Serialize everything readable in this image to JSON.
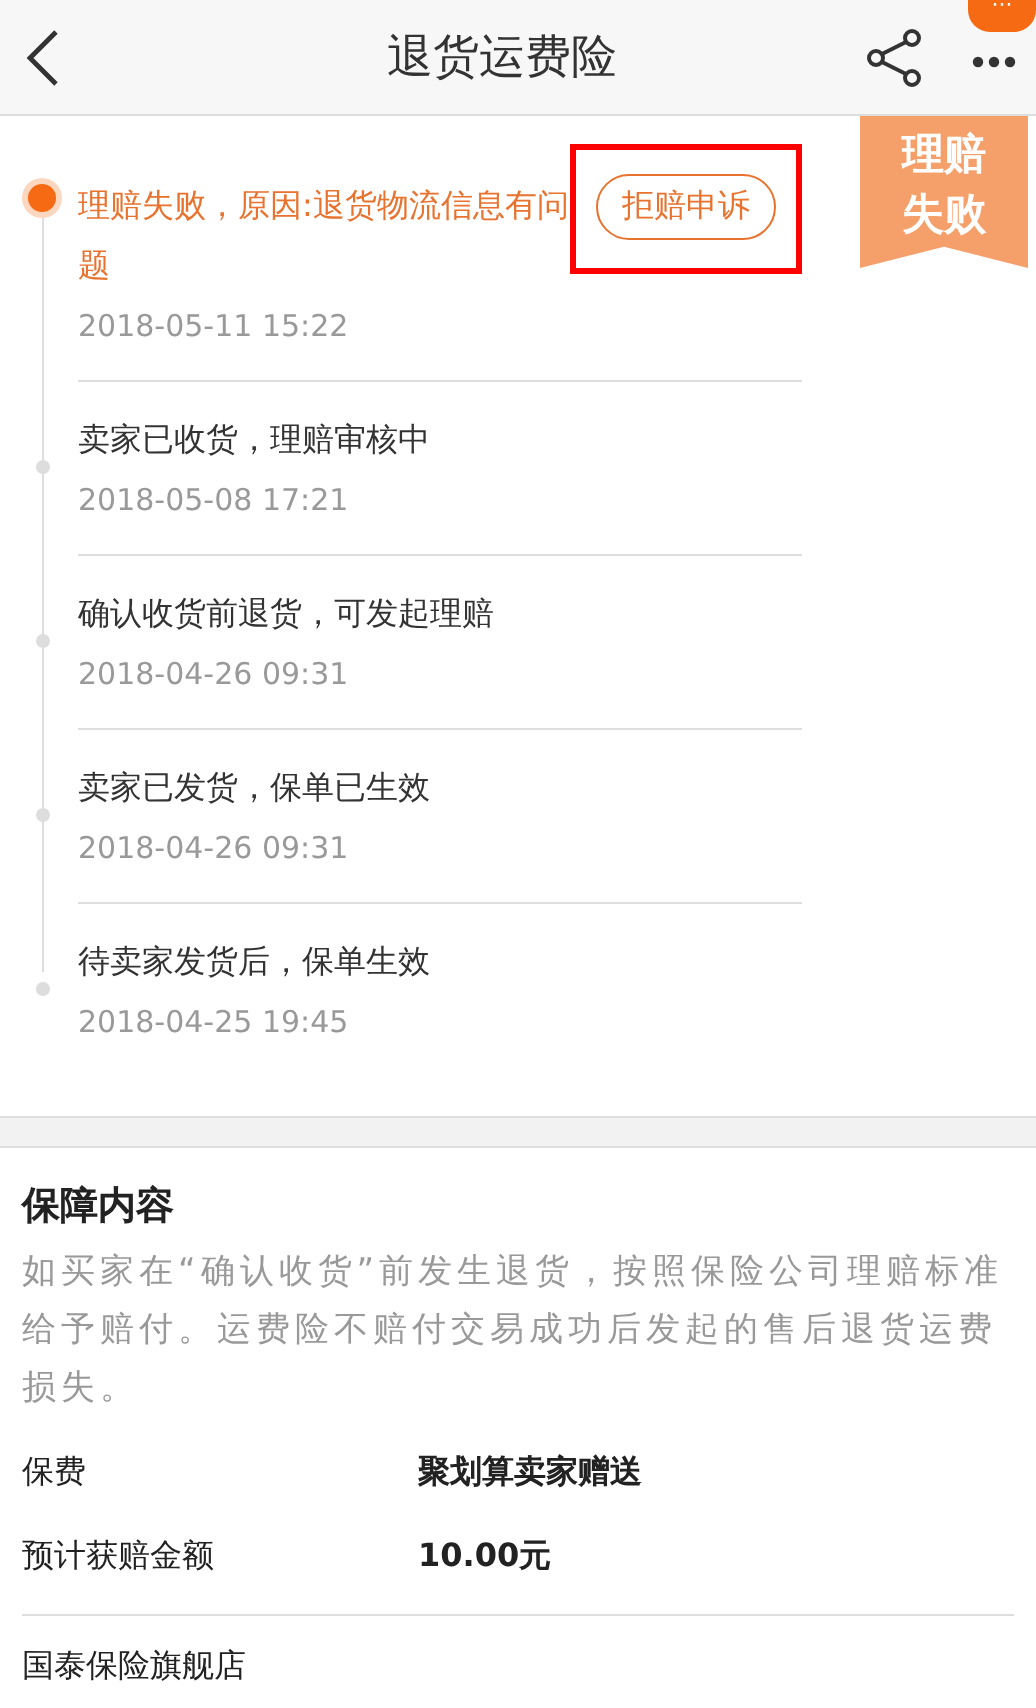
{
  "header": {
    "title": "退货运费险",
    "notification": "···"
  },
  "status_ribbon": {
    "text": "理赔失败"
  },
  "timeline": [
    {
      "text": "理赔失败，原因:退货物流信息有问题",
      "time": "2018-05-11 15:22",
      "current": true,
      "action": {
        "label": "拒赔申诉",
        "highlighted": true
      }
    },
    {
      "text": "卖家已收货，理赔审核中",
      "time": "2018-05-08 17:21",
      "current": false
    },
    {
      "text": "确认收货前退货，可发起理赔",
      "time": "2018-04-26 09:31",
      "current": false
    },
    {
      "text": "卖家已发货，保单已生效",
      "time": "2018-04-26 09:31",
      "current": false
    },
    {
      "text": "待卖家发货后，保单生效",
      "time": "2018-04-25 19:45",
      "current": false
    }
  ],
  "coverage": {
    "title": "保障内容",
    "description": "如买家在“确认收货”前发生退货，按照保险公司理赔标准给予赔付。运费险不赔付交易成功后发起的售后退货运费损失。",
    "rows": [
      {
        "label": "保费",
        "value": "聚划算卖家赠送"
      },
      {
        "label": "预计获赔金额",
        "value": "10.00元"
      }
    ],
    "insurer": "国泰保险旗舰店"
  }
}
